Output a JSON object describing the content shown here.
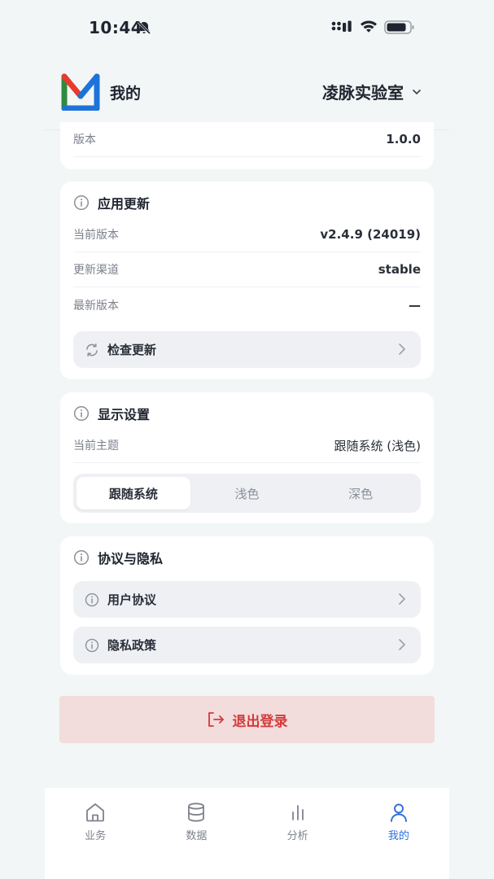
{
  "status_bar": {
    "time": "10:44"
  },
  "header": {
    "title": "我的",
    "org": "凌脉实验室"
  },
  "about": {
    "version_label": "版本",
    "version_value": "1.0.0"
  },
  "update": {
    "title": "应用更新",
    "rows": [
      {
        "label": "当前版本",
        "value": "v2.4.9 (24019)"
      },
      {
        "label": "更新渠道",
        "value": "stable"
      },
      {
        "label": "最新版本",
        "value": "—"
      }
    ],
    "check_label": "检查更新"
  },
  "display": {
    "title": "显示设置",
    "theme_label": "当前主题",
    "theme_value": "跟随系统 (浅色)",
    "options": [
      "跟随系统",
      "浅色",
      "深色"
    ]
  },
  "privacy": {
    "title": "协议与隐私",
    "items": [
      "用户协议",
      "隐私政策"
    ]
  },
  "logout_label": "退出登录",
  "tabs": [
    "业务",
    "数据",
    "分析",
    "我的"
  ],
  "colors": {
    "accent": "#2f6fe0",
    "danger": "#d33a3a",
    "danger_bg": "#f3dcdc"
  }
}
